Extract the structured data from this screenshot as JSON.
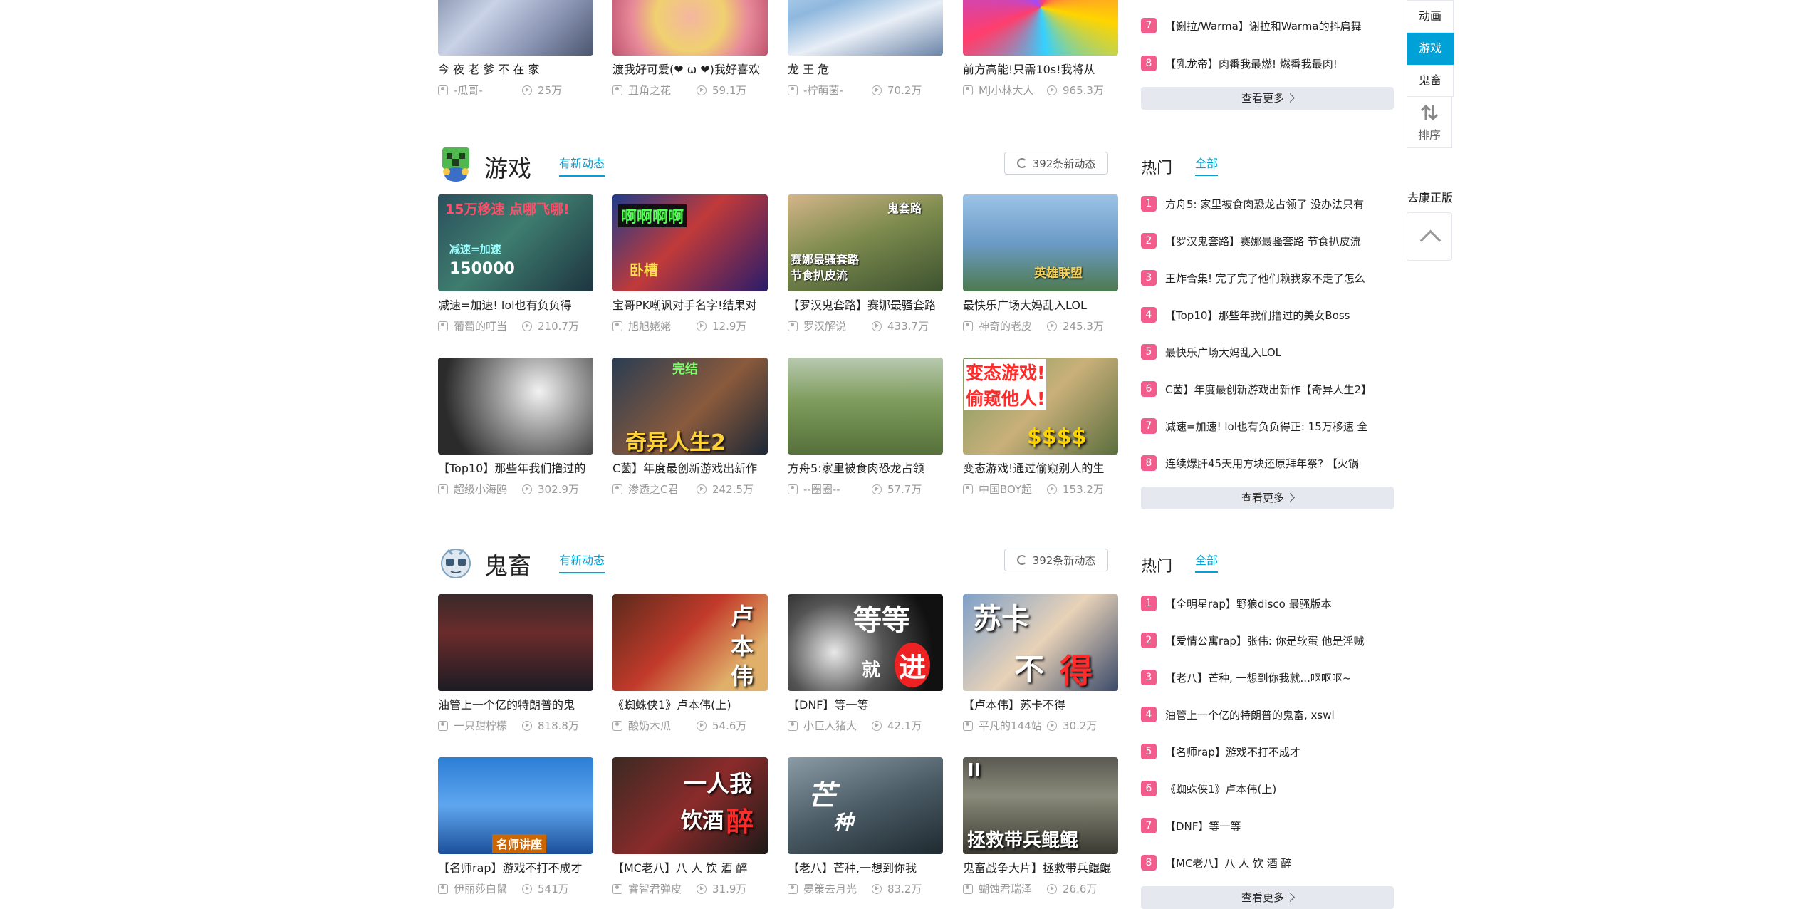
{
  "top_row": [
    {
      "title": "今 夜 老 爹 不 在 家",
      "uploader": "-瓜哥-",
      "plays": "25万"
    },
    {
      "title": "渡我好可爱(❤ ω ❤)我好喜欢",
      "uploader": "丑角之花",
      "plays": "59.1万"
    },
    {
      "title": "龙 王 危",
      "uploader": "-柠萌菌-",
      "plays": "70.2万"
    },
    {
      "title": "前方高能!只需10s!我将从",
      "uploader": "MJ小林大人",
      "plays": "965.3万"
    }
  ],
  "top_rank": {
    "items": [
      {
        "num": "7",
        "text": "【谢拉/Warma】谢拉和Warma的抖肩舞"
      },
      {
        "num": "8",
        "text": "【乳龙帝】肉番我最燃! 燃番我最肉!"
      }
    ],
    "more": "查看更多"
  },
  "sections": [
    {
      "title": "游戏",
      "new_label": "有新动态",
      "refresh": "392条新动态",
      "rank_title": "热门",
      "rank_tab": "全部",
      "videos": [
        {
          "title": "减速=加速! lol也有负负得",
          "uploader": "葡萄的叮当",
          "plays": "210.7万",
          "thumb_text": [
            "15万移速 点哪飞哪!",
            "减速=加速",
            "150000"
          ]
        },
        {
          "title": "宝哥PK嘲讽对手名字!结果对",
          "uploader": "旭旭姥姥",
          "plays": "12.9万",
          "thumb_text": [
            "啊啊啊啊",
            "卧槽"
          ]
        },
        {
          "title": "【罗汉鬼套路】赛娜最骚套路",
          "uploader": "罗汉解说",
          "plays": "433.7万",
          "thumb_text": [
            "赛娜最骚套路",
            "节食扒皮流",
            "鬼套路"
          ]
        },
        {
          "title": "最快乐广场大妈乱入LOL",
          "uploader": "神奇的老皮",
          "plays": "245.3万",
          "thumb_text": [
            "英雄联盟"
          ]
        },
        {
          "title": "【Top10】那些年我们撸过的",
          "uploader": "超级小海鸥",
          "plays": "302.9万",
          "thumb_text": []
        },
        {
          "title": "C菌】年度最创新游戏出新作",
          "uploader": "渗透之C君",
          "plays": "242.5万",
          "thumb_text": [
            "完结",
            "奇异人生2"
          ]
        },
        {
          "title": "方舟5:家里被食肉恐龙占领",
          "uploader": "--圈圈--",
          "plays": "57.7万",
          "thumb_text": []
        },
        {
          "title": "变态游戏!通过偷窥别人的生",
          "uploader": "中国BOY超",
          "plays": "153.2万",
          "thumb_text": [
            "变态游戏!",
            "偷窥他人!",
            "$$$$"
          ]
        }
      ],
      "rank": [
        {
          "num": "1",
          "text": "方舟5: 家里被食肉恐龙占领了 没办法只有"
        },
        {
          "num": "2",
          "text": "【罗汉鬼套路】赛娜最骚套路 节食扒皮流"
        },
        {
          "num": "3",
          "text": "王炸合集! 完了完了他们赖我家不走了怎么"
        },
        {
          "num": "4",
          "text": "【Top10】那些年我们撸过的美女Boss"
        },
        {
          "num": "5",
          "text": "最快乐广场大妈乱入LOL"
        },
        {
          "num": "6",
          "text": "C菌】年度最创新游戏出新作【奇异人生2】"
        },
        {
          "num": "7",
          "text": "减速=加速! lol也有负负得正: 15万移速 全"
        },
        {
          "num": "8",
          "text": "连续爆肝45天用方块还原拜年祭? 【火锅"
        }
      ],
      "more": "查看更多"
    },
    {
      "title": "鬼畜",
      "new_label": "有新动态",
      "refresh": "392条新动态",
      "rank_title": "热门",
      "rank_tab": "全部",
      "videos": [
        {
          "title": "油管上一个亿的特朗普的鬼",
          "uploader": "一只甜柠檬",
          "plays": "818.8万",
          "thumb_text": []
        },
        {
          "title": "《蜘蛛侠1》卢本伟(上)",
          "uploader": "酸奶木瓜",
          "plays": "54.6万",
          "thumb_text": [
            "卢",
            "本",
            "伟"
          ]
        },
        {
          "title": "【DNF】等一等",
          "uploader": "小巨人猪大",
          "plays": "42.1万",
          "thumb_text": [
            "等等",
            "就",
            "进"
          ]
        },
        {
          "title": "【卢本伟】苏卡不得",
          "uploader": "平凡的144站",
          "plays": "30.2万",
          "thumb_text": [
            "苏卡",
            "不",
            "得"
          ]
        },
        {
          "title": "【名师rap】游戏不打不成才",
          "uploader": "伊丽莎白鼠",
          "plays": "541万",
          "thumb_text": [
            "名师讲座"
          ]
        },
        {
          "title": "【MC老八】八 人 饮 酒 醉",
          "uploader": "睿智君弹皮",
          "plays": "31.9万",
          "thumb_text": [
            "一人我",
            "饮酒",
            "醉"
          ]
        },
        {
          "title": "【老八】芒种,一想到你我",
          "uploader": "晏策去月光",
          "plays": "83.2万",
          "thumb_text": [
            "芒",
            "种"
          ]
        },
        {
          "title": "鬼畜战争大片】拯救带兵鲲鲲",
          "uploader": "蝴蚀君瑞泽",
          "plays": "26.6万",
          "thumb_text": [
            "II",
            "拯救带兵鲲鲲"
          ]
        }
      ],
      "rank": [
        {
          "num": "1",
          "text": "【全明星rap】野狼disco 最骚版本"
        },
        {
          "num": "2",
          "text": "【爱情公寓rap】张伟: 你是软蛋 他是淫贼"
        },
        {
          "num": "3",
          "text": "【老八】芒种, 一想到你我就...呕呕呕~"
        },
        {
          "num": "4",
          "text": "油管上一个亿的特朗普的鬼畜, xswl"
        },
        {
          "num": "5",
          "text": "【名师rap】游戏不打不成才"
        },
        {
          "num": "6",
          "text": "《蜘蛛侠1》卢本伟(上)"
        },
        {
          "num": "7",
          "text": "【DNF】等一等"
        },
        {
          "num": "8",
          "text": "【MC老八】八 人 饮 酒 醉"
        }
      ],
      "more": "查看更多"
    }
  ],
  "sidenav": {
    "items": [
      "动画",
      "游戏",
      "鬼畜"
    ],
    "active": "游戏",
    "sort": "排序",
    "kang": "去康正版"
  },
  "colors": {
    "accent": "#00a1d6",
    "rank_badge": "#f25d8e",
    "more_bg": "#e5e9ef"
  }
}
